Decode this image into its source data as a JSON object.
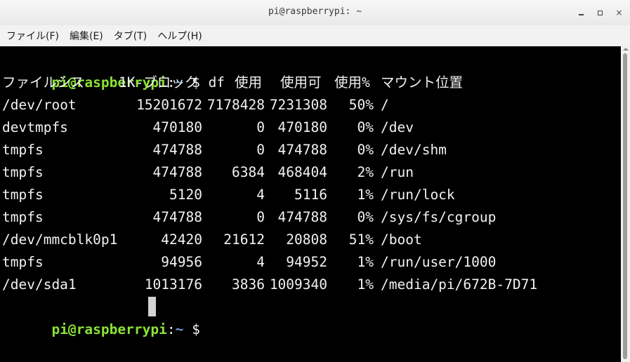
{
  "window": {
    "title": "pi@raspberrypi: ~",
    "controls": {
      "minimize": "minimize",
      "maximize": "maximize",
      "close": "×"
    }
  },
  "menu": [
    "ファイル(F)",
    "編集(E)",
    "タブ(T)",
    "ヘルプ(H)"
  ],
  "prompt": {
    "user_host": "pi@raspberrypi",
    "separator": ":",
    "path": "~",
    "dollar": " $ "
  },
  "command": "df",
  "df": {
    "headers": [
      "ファイルシス",
      "1K-ブロック",
      "使用",
      "使用可",
      "使用%",
      "マウント位置"
    ],
    "rows": [
      [
        "/dev/root",
        "15201672",
        "7178428",
        "7231308",
        "50%",
        "/"
      ],
      [
        "devtmpfs",
        "470180",
        "0",
        "470180",
        "0%",
        "/dev"
      ],
      [
        "tmpfs",
        "474788",
        "0",
        "474788",
        "0%",
        "/dev/shm"
      ],
      [
        "tmpfs",
        "474788",
        "6384",
        "468404",
        "2%",
        "/run"
      ],
      [
        "tmpfs",
        "5120",
        "4",
        "5116",
        "1%",
        "/run/lock"
      ],
      [
        "tmpfs",
        "474788",
        "0",
        "474788",
        "0%",
        "/sys/fs/cgroup"
      ],
      [
        "/dev/mmcblk0p1",
        "42420",
        "21612",
        "20808",
        "51%",
        "/boot"
      ],
      [
        "tmpfs",
        "94956",
        "4",
        "94952",
        "1%",
        "/run/user/1000"
      ],
      [
        "/dev/sda1",
        "1013176",
        "3836",
        "1009340",
        "1%",
        "/media/pi/672B-7D71"
      ]
    ]
  },
  "colors": {
    "terminal_bg": "#000000",
    "terminal_fg": "#f2f2f2",
    "prompt_user": "#8ae234",
    "prompt_path": "#729fcf"
  }
}
